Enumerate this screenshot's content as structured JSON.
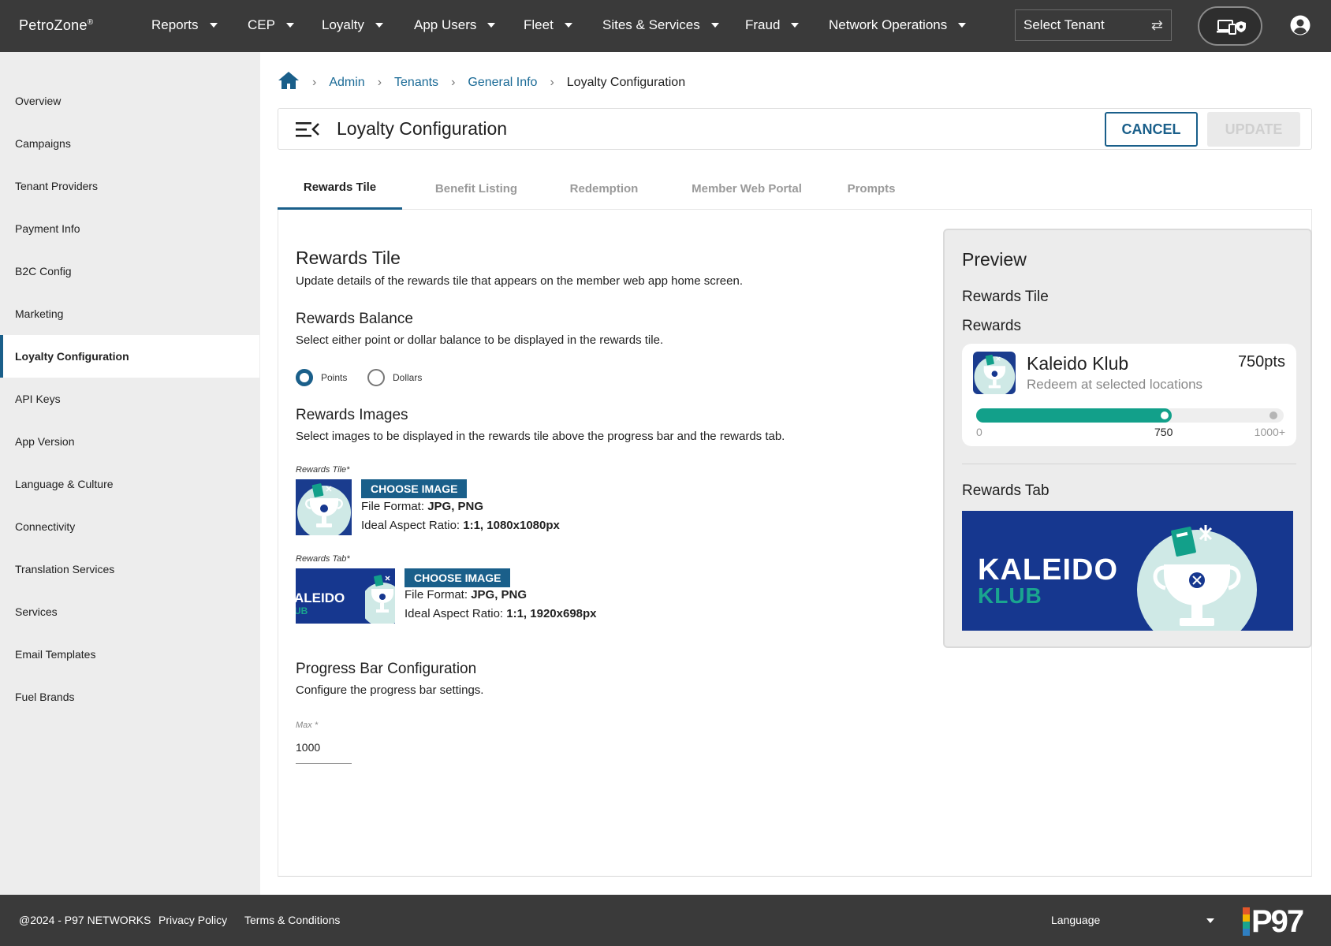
{
  "app": {
    "brand": "PetroZone",
    "brand_mark": "®",
    "nav": [
      "Reports",
      "CEP",
      "Loyalty",
      "App Users",
      "Fleet",
      "Sites & Services",
      "Fraud",
      "Network Operations"
    ],
    "tenant_select_placeholder": "Select Tenant"
  },
  "sidebar": {
    "items": [
      "Overview",
      "Campaigns",
      "Tenant Providers",
      "Payment Info",
      "B2C Config",
      "Marketing",
      "Loyalty Configuration",
      "API Keys",
      "App Version",
      "Language & Culture",
      "Connectivity",
      "Translation Services",
      "Services",
      "Email Templates",
      "Fuel Brands"
    ],
    "active": "Loyalty Configuration"
  },
  "breadcrumb": {
    "links": [
      "Admin",
      "Tenants",
      "General Info"
    ],
    "current": "Loyalty Configuration"
  },
  "header": {
    "title": "Loyalty Configuration",
    "cancel_label": "CANCEL",
    "update_label": "UPDATE"
  },
  "tabs": [
    "Rewards Tile",
    "Benefit Listing",
    "Redemption",
    "Member Web Portal",
    "Prompts"
  ],
  "rewards_tile": {
    "title": "Rewards Tile",
    "description": "Update details of the rewards tile that appears on the member web app home screen.",
    "balance": {
      "title": "Rewards Balance",
      "description": "Select either point or dollar balance to be displayed in the rewards tile.",
      "options": [
        "Points",
        "Dollars"
      ],
      "selected": "Points"
    },
    "images": {
      "title": "Rewards Images",
      "description": "Select images to be displayed in the rewards tile above the progress bar and the rewards tab.",
      "tile": {
        "label": "Rewards Tile*",
        "button": "CHOOSE IMAGE",
        "format_label": "File Format:",
        "format_value": "JPG, PNG",
        "ratio_label": "Ideal Aspect Ratio:",
        "ratio_value": "1:1, 1080x1080px"
      },
      "tab": {
        "label": "Rewards Tab*",
        "button": "CHOOSE IMAGE",
        "format_label": "File Format:",
        "format_value": "JPG, PNG",
        "ratio_label": "Ideal Aspect Ratio:",
        "ratio_value": "1:1, 1920x698px",
        "thumb_text_1": "ALEIDO",
        "thumb_text_2": "UB"
      }
    },
    "progress": {
      "title": "Progress Bar Configuration",
      "description": "Configure the progress bar settings.",
      "max_label": "Max *",
      "max_value": "1000"
    }
  },
  "preview": {
    "title": "Preview",
    "section_tile": "Rewards Tile",
    "section_rewards": "Rewards",
    "card": {
      "name": "Kaleido Klub",
      "subtitle": "Redeem at selected locations",
      "points": "750pts",
      "progress_value": 750,
      "progress_max": 1000,
      "tick_min": "0",
      "tick_mid": "750",
      "tick_max": "1000+"
    },
    "section_tab": "Rewards Tab",
    "banner_line1": "KALEIDO",
    "banner_line2": "KLUB"
  },
  "footer": {
    "copyright": "@2024 - P97 NETWORKS",
    "privacy": "Privacy Policy",
    "terms": "Terms & Conditions",
    "language": "Language",
    "logo": "P97"
  },
  "colors": {
    "topbar": "#3a3a3a",
    "accent": "#1a5f8a",
    "progress": "#12a08a",
    "banner": "#16378f"
  }
}
